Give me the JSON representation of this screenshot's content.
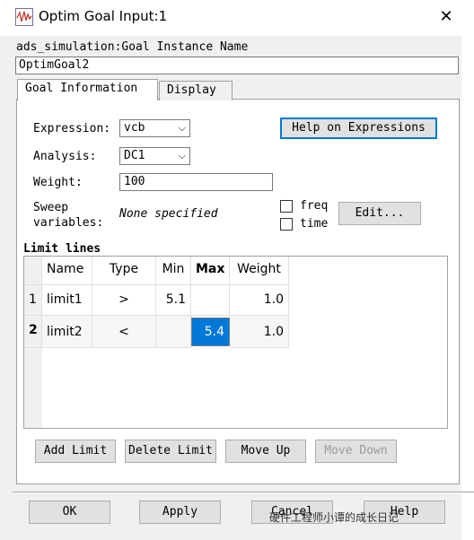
{
  "window": {
    "title": "Optim Goal Input:1"
  },
  "instance": {
    "label": "ads_simulation:Goal Instance Name",
    "value": "OptimGoal2"
  },
  "tabs": [
    {
      "label": "Goal Information"
    },
    {
      "label": "Display"
    }
  ],
  "form": {
    "expression_label": "Expression:",
    "expression_value": "vcb",
    "analysis_label": "Analysis:",
    "analysis_value": "DC1",
    "weight_label": "Weight:",
    "weight_value": "100",
    "sweep_label_1": "Sweep",
    "sweep_label_2": "variables:",
    "sweep_value": "None specified",
    "freq_label": "freq",
    "time_label": "time",
    "edit_label": "Edit...",
    "help_label": "Help on Expressions"
  },
  "limits": {
    "title": "Limit lines",
    "columns": [
      "Name",
      "Type",
      "Min",
      "Max",
      "Weight"
    ],
    "rows": [
      {
        "index": "1",
        "name": "limit1",
        "type": ">",
        "min": "5.1",
        "max": "",
        "weight": "1.0"
      },
      {
        "index": "2",
        "name": "limit2",
        "type": "<",
        "min": "",
        "max": "5.4",
        "weight": "1.0"
      }
    ]
  },
  "limit_buttons": {
    "add": "Add Limit",
    "delete": "Delete Limit",
    "move_up": "Move Up",
    "move_down": "Move Down"
  },
  "dialog_buttons": {
    "ok": "OK",
    "apply": "Apply",
    "cancel": "Cancel",
    "help": "Help"
  },
  "watermark": "硬件工程师小谭的成长日记",
  "colors": {
    "accent": "#0078d7",
    "selected_cell": "#0078d7"
  }
}
